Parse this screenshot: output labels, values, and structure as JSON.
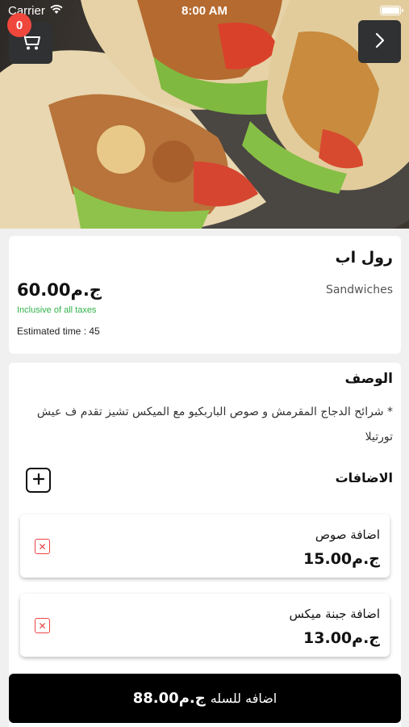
{
  "status_bar": {
    "carrier": "Carrier",
    "time": "8:00 AM"
  },
  "header": {
    "cart_count": "0",
    "cart_icon": "cart-icon",
    "next_icon": "chevron-right-icon"
  },
  "product": {
    "name": "رول اب",
    "category": "Sandwiches",
    "price": "60.00",
    "currency": "ج.م",
    "tax_note": "Inclusive of all taxes",
    "estimated_time": "Estimated time : 45"
  },
  "description": {
    "title": "الوصف",
    "text": "* شرائح الدجاج المقرمش و صوص الباربكيو مع الميكس تشيز تقدم ف عيش تورتيلا"
  },
  "addons": {
    "title": "الاضافات",
    "add_icon": "plus-icon",
    "items": [
      {
        "name": "اضافة صوص",
        "price": "15.00",
        "currency": "ج.م"
      },
      {
        "name": "اضافة جبنة ميكس",
        "price": "13.00",
        "currency": "ج.م"
      }
    ]
  },
  "cta": {
    "label": "اضافه للسله",
    "currency": "ج.م",
    "price": "88.00"
  },
  "colors": {
    "accent": "#000000",
    "badge": "#f0473d",
    "tax_green": "#31b34a",
    "remove_red": "#ee4444"
  }
}
